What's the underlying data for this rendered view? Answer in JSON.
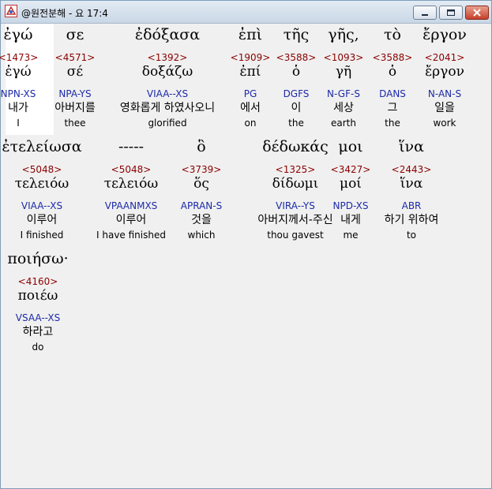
{
  "window": {
    "title": "@원전분해 - 요 17:4",
    "minimize_label": "minimize",
    "maximize_label": "maximize",
    "close_label": "close"
  },
  "rows": [
    [
      {
        "greek": "ἐγώ",
        "strongs": "<1473>",
        "lemma": "ἐγώ",
        "morph": "NPN-XS",
        "korean": "내가",
        "english": "I"
      },
      {
        "greek": "σε",
        "strongs": "<4571>",
        "lemma": "σέ",
        "morph": "NPA-YS",
        "korean": "아버지를",
        "english": "thee"
      },
      {
        "greek": "ἐδόξασα",
        "strongs": "<1392>",
        "lemma": "δοξάζω",
        "morph": "VIAA--XS",
        "korean": "영화롭게 하였사오니",
        "english": "glorified"
      },
      {
        "greek": "ἐπὶ",
        "strongs": "<1909>",
        "lemma": "ἐπί",
        "morph": "PG",
        "korean": "에서",
        "english": "on"
      },
      {
        "greek": "τῆς",
        "strongs": "<3588>",
        "lemma": "ὁ",
        "morph": "DGFS",
        "korean": "이",
        "english": "the"
      },
      {
        "greek": "γῆς,",
        "strongs": "<1093>",
        "lemma": "γῆ",
        "morph": "N-GF-S",
        "korean": "세상",
        "english": "earth"
      },
      {
        "greek": "τὸ",
        "strongs": "<3588>",
        "lemma": "ὁ",
        "morph": "DANS",
        "korean": "그",
        "english": "the"
      },
      {
        "greek": "ἔργον",
        "strongs": "<2041>",
        "lemma": "ἔργον",
        "morph": "N-AN-S",
        "korean": "일을",
        "english": "work"
      }
    ],
    [
      {
        "greek": "ἐτελείωσα",
        "strongs": "<5048>",
        "lemma": "τελειόω",
        "morph": "VIAA--XS",
        "korean": "이루어",
        "english": "I finished"
      },
      {
        "greek": "-----",
        "strongs": "<5048>",
        "lemma": "τελειόω",
        "morph": "VPAANMXS",
        "korean": "이루어",
        "english": "I have finished"
      },
      {
        "greek": "ὃ",
        "strongs": "<3739>",
        "lemma": "ὅς",
        "morph": "APRAN-S",
        "korean": "것을",
        "english": "which"
      },
      {
        "greek": "δέδωκάς",
        "strongs": "<1325>",
        "lemma": "δίδωμι",
        "morph": "VIRA--YS",
        "korean": "아버지께서-주신",
        "english": "thou gavest"
      },
      {
        "greek": "μοι",
        "strongs": "<3427>",
        "lemma": "μοί",
        "morph": "NPD-XS",
        "korean": "내게",
        "english": "me"
      },
      {
        "greek": "ἵνα",
        "strongs": "<2443>",
        "lemma": "ἵνα",
        "morph": "ABR",
        "korean": "하기 위하여",
        "english": "to"
      }
    ],
    [
      {
        "greek": "ποιήσω·",
        "strongs": "<4160>",
        "lemma": "ποιέω",
        "morph": "VSAA--XS",
        "korean": "하라고",
        "english": "do"
      }
    ]
  ]
}
